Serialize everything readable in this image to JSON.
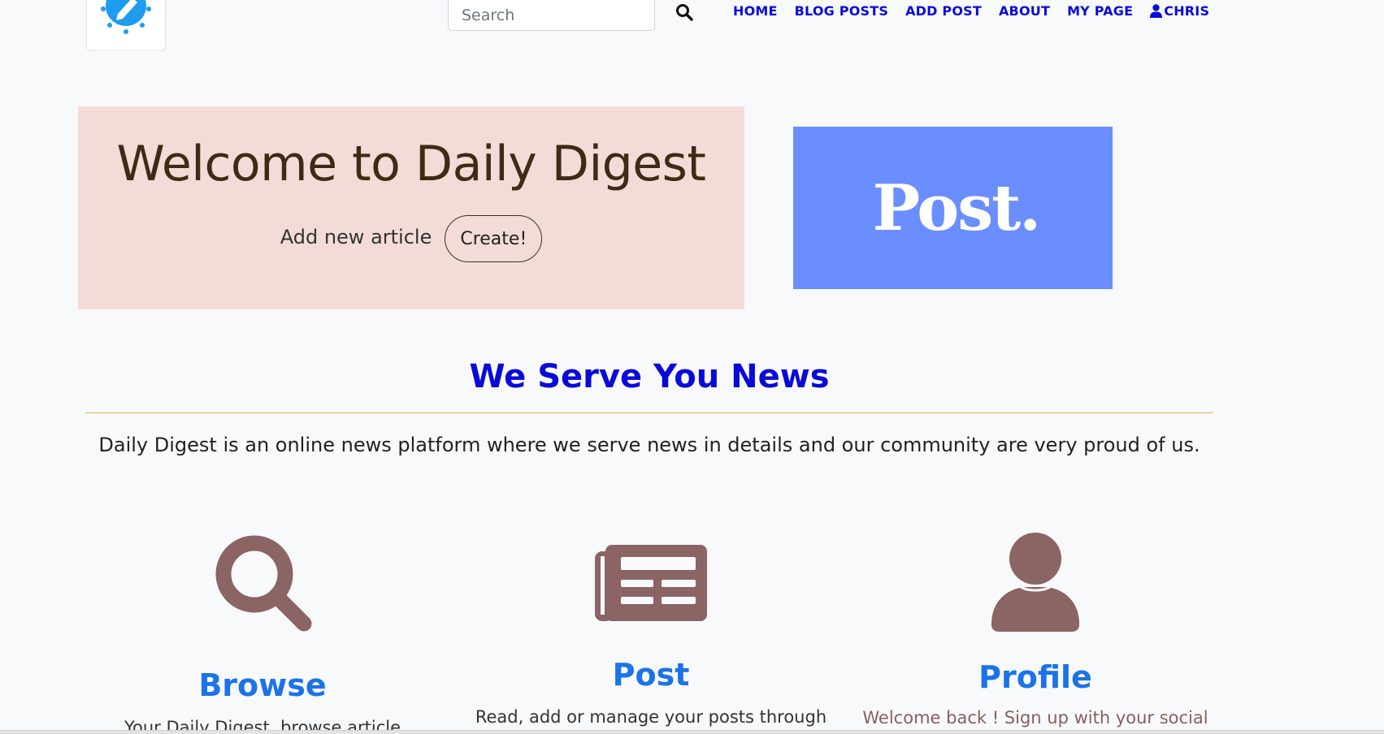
{
  "nav": {
    "logo_icon": "pencil-sun-logo-icon",
    "search_placeholder": "Search",
    "search_icon": "search-icon",
    "links": [
      {
        "label": "HOME"
      },
      {
        "label": "BLOG POSTS"
      },
      {
        "label": "ADD POST"
      },
      {
        "label": "ABOUT"
      },
      {
        "label": "MY PAGE"
      },
      {
        "label": "CHRIS",
        "icon": "user-icon"
      }
    ]
  },
  "hero": {
    "title": "Welcome to Daily Digest",
    "add_label": "Add new article",
    "create_button": "Create!",
    "banner_text": "Post."
  },
  "section": {
    "title": "We Serve You News",
    "description": "Daily Digest is an online news platform where we serve news in details and our community are very proud of us."
  },
  "features": [
    {
      "icon": "magnifier-icon",
      "title": "Browse",
      "description": "Your Daily Digest, browse article"
    },
    {
      "icon": "newspaper-icon",
      "title": "Post",
      "description": "Read, add or manage your posts through"
    },
    {
      "icon": "person-icon",
      "title": "Profile",
      "description": "Welcome back ! Sign up with your social"
    }
  ],
  "colors": {
    "nav_link": "#0a0ad8",
    "hero_bg": "#f3dcd8",
    "hero_title": "#3f2a14",
    "banner_bg": "#6b8efe",
    "feature_icon": "#8b6464",
    "feature_title": "#1a73e8",
    "divider": "#d8b86a"
  }
}
